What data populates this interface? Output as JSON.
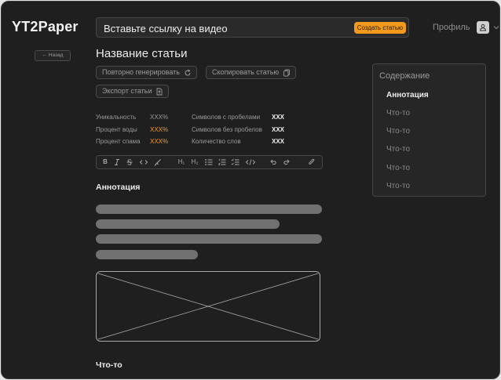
{
  "app": {
    "logo": "YT2Paper"
  },
  "header": {
    "url_placeholder": "Вставьте ссылку на видео",
    "create_button": "Создать статью",
    "profile_label": "Профиль"
  },
  "nav": {
    "back_label": "← Назад"
  },
  "article": {
    "title": "Название статьи",
    "actions": {
      "regenerate": "Повторно генерировать",
      "copy": "Скопировать статью",
      "export": "Экспорт статьи"
    },
    "stats": {
      "uniqueness": {
        "label": "Уникальность",
        "value": "XXX%"
      },
      "water": {
        "label": "Процент воды",
        "value": "XXX%"
      },
      "spam": {
        "label": "Процент спама",
        "value": "XXX%"
      },
      "chars_with_spaces": {
        "label": "Символов с пробелами",
        "value": "XXX"
      },
      "chars_without_spaces": {
        "label": "Символов без пробелов",
        "value": "XXX"
      },
      "word_count": {
        "label": "Количество слов",
        "value": "XXX"
      }
    },
    "toolbar": {
      "bold": "B",
      "h1": "H₁",
      "h2": "H₂"
    },
    "sections": [
      {
        "heading": "Аннотация"
      },
      {
        "heading": "Что-то"
      }
    ]
  },
  "toc": {
    "title": "Содержание",
    "items": [
      "Аннотация",
      "Что-то",
      "Что-то",
      "Что-то",
      "Что-то",
      "Что-то"
    ],
    "active_index": 0
  },
  "colors": {
    "accent": "#f39a1d",
    "background": "#1f1f1f",
    "skeleton": "#717171"
  }
}
